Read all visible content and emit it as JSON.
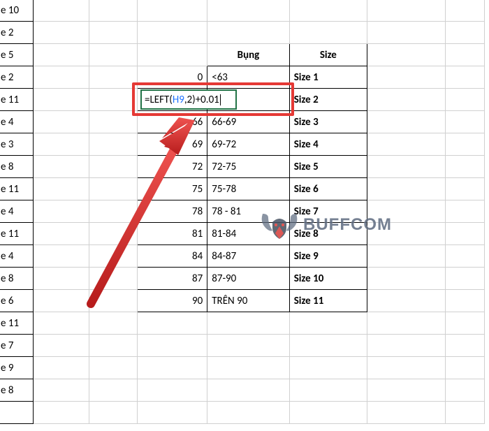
{
  "colA_values": [
    "e 10",
    "e 2",
    "e 5",
    "e 2",
    "e 11",
    "e 4",
    "e 3",
    "e 8",
    "e 11",
    "e 4",
    "e 11",
    "e 4",
    "e 8",
    "e 6",
    "e 11",
    "e 7",
    "e 9",
    "e 8",
    ""
  ],
  "nums": [
    0,
    "",
    66,
    69,
    72,
    75,
    78,
    81,
    84,
    87,
    90
  ],
  "lookup_header": {
    "bung": "Bụng",
    "size": "Size"
  },
  "lookup_rows": [
    {
      "b": "<63",
      "s": "Size 1"
    },
    {
      "b": "",
      "s": "Size 2"
    },
    {
      "b": "66-69",
      "s": "Size 3"
    },
    {
      "b": "69-72",
      "s": "Size 4"
    },
    {
      "b": "72-75",
      "s": "Size 5"
    },
    {
      "b": "75-78",
      "s": "Size 6"
    },
    {
      "b": "78 - 81",
      "s": "Size 7"
    },
    {
      "b": "81-84",
      "s": "Size 8"
    },
    {
      "b": "84-87",
      "s": "Size 9"
    },
    {
      "b": "87-90",
      "s": "Size 10"
    },
    {
      "b": "TRÊN 90",
      "s": "Size 11"
    }
  ],
  "active_formula": {
    "prefix": "=LEFT(",
    "ref": "H9",
    "suffix": ",2)+0.01"
  },
  "watermark": {
    "brand_a": "BUFF",
    "brand_b": "COM"
  }
}
